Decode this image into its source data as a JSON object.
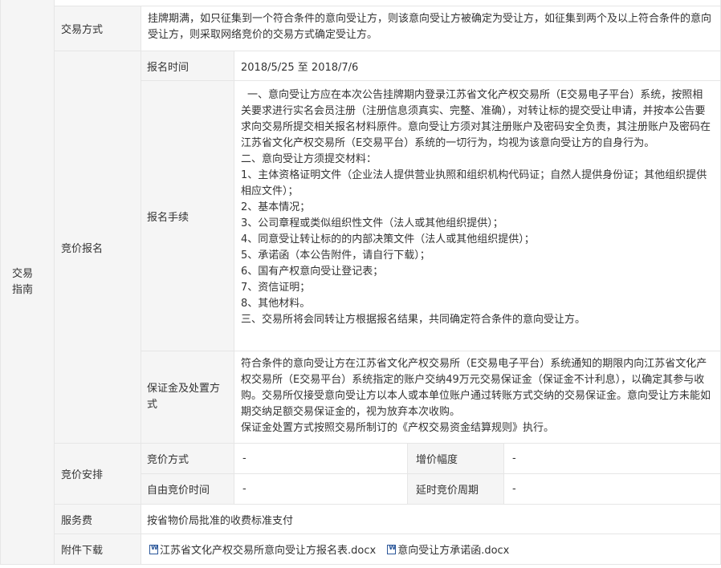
{
  "section_label": "交易指南",
  "trade_method": {
    "label": "交易方式",
    "text": "挂牌期满，如只征集到一个符合条件的意向受让方，则该意向受让方被确定为受让方，如征集到两个及以上符合条件的意向受让方，则采取网络竞价的交易方式确定受让方。"
  },
  "bidding_registration": {
    "label": "竞价报名",
    "reg_time": {
      "label": "报名时间",
      "value": "2018/5/25 至 2018/7/6"
    },
    "procedure": {
      "label": "报名手续",
      "paragraphs": [
        "一、意向受让方应在本次公告挂牌期内登录江苏省文化产权交易所（E交易电子平台）系统，按照相关要求进行实名会员注册（注册信息须真实、完整、准确），对转让标的提交受让申请，并按本公告要求向交易所提交相关报名材料原件。意向受让方须对其注册账户及密码安全负责，其注册账户及密码在江苏省文化产权交易所（E交易平台）系统的一切行为，均视为该意向受让方的自身行为。",
        "二、意向受让方须提交材料：",
        "1、主体资格证明文件（企业法人提供营业执照和组织机构代码证；自然人提供身份证；其他组织提供相应文件）；",
        "2、基本情况；",
        "3、公司章程或类似组织性文件（法人或其他组织提供）；",
        "4、同意受让转让标的的内部决策文件（法人或其他组织提供）；",
        "5、承诺函（本公告附件，请自行下载）；",
        "6、国有产权意向受让登记表；",
        "7、资信证明；",
        "8、其他材料。",
        "三、交易所将会同转让方根据报名结果，共同确定符合条件的意向受让方。"
      ]
    },
    "deposit": {
      "label": "保证金及处置方式",
      "paragraphs": [
        "符合条件的意向受让方在江苏省文化产权交易所（E交易电子平台）系统通知的期限内向江苏省文化产权交易所（E交易平台）系统指定的账户交纳49万元交易保证金（保证金不计利息），以确定其参与收购。交易所仅接受意向受让方以本人或本单位账户通过转账方式交纳的交易保证金。意向受让方未能如期交纳足额交易保证金的，视为放弃本次收购。",
        "保证金处置方式按照交易所制订的《产权交易资金结算规则》执行。"
      ]
    }
  },
  "bidding_arrangement": {
    "label": "竞价安排",
    "method_label": "竞价方式",
    "method_value": "-",
    "increment_label": "增价幅度",
    "increment_value": "-",
    "free_time_label": "自由竞价时间",
    "free_time_value": "-",
    "delay_label": "延时竞价周期",
    "delay_value": "-"
  },
  "service_fee": {
    "label": "服务费",
    "value": "按省物价局批准的收费标准支付"
  },
  "attachments": {
    "label": "附件下载",
    "files": [
      {
        "name": "江苏省文化产权交易所意向受让方报名表.docx",
        "icon": "word-doc-icon"
      },
      {
        "name": "意向受让方承诺函.docx",
        "icon": "word-doc-icon"
      }
    ]
  },
  "colors": {
    "label_bg": "#f5f5f5",
    "border": "#e6e6e6",
    "text": "#333333"
  }
}
